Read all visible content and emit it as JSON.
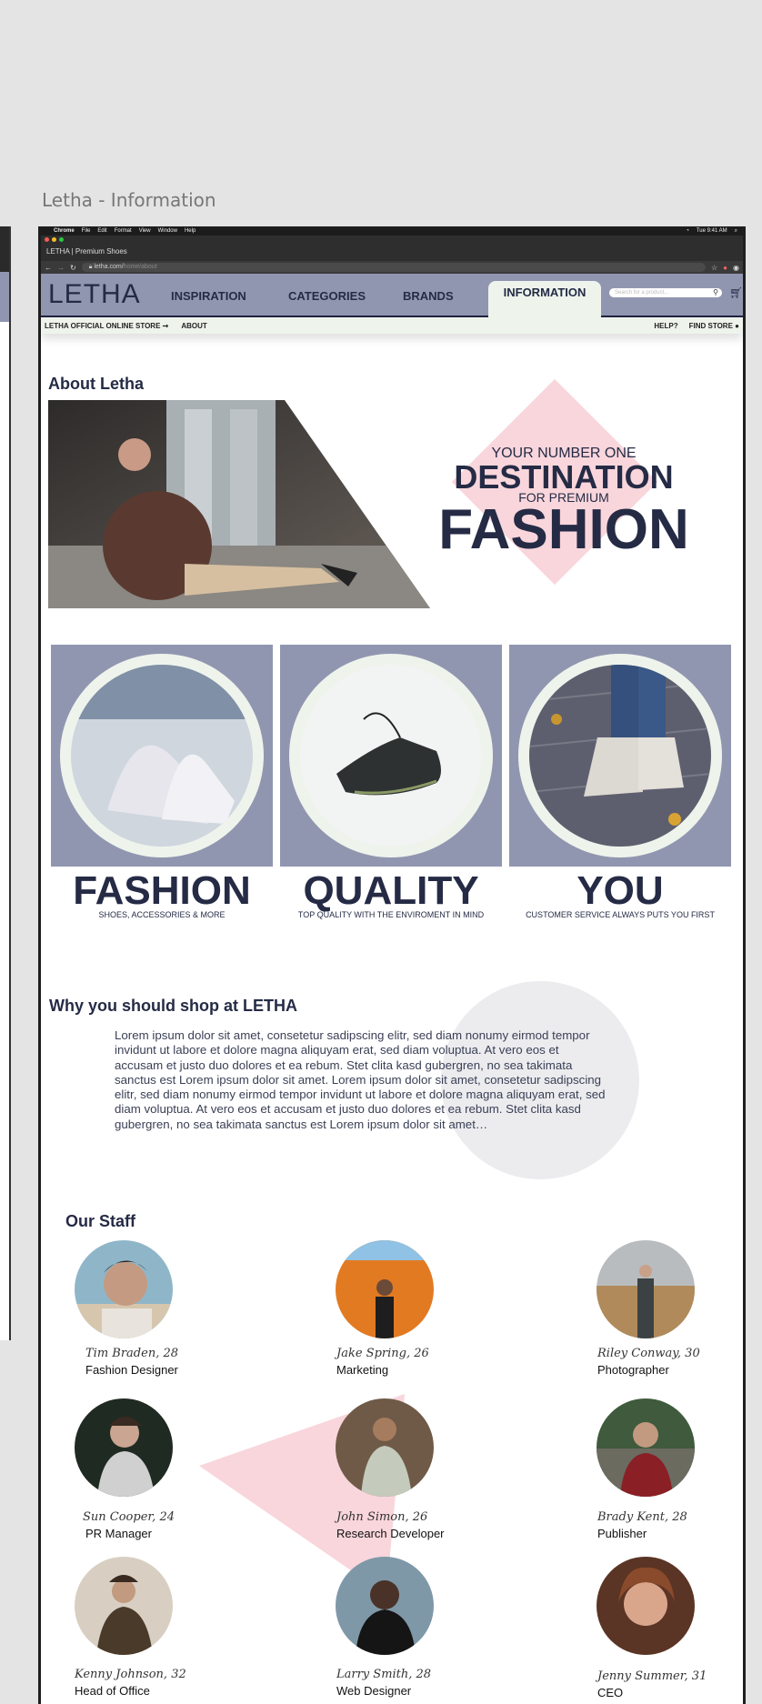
{
  "artboard_title": "Letha - Information",
  "os_menu": [
    "Chrome",
    "File",
    "Edit",
    "Format",
    "View",
    "Window",
    "Help"
  ],
  "os_time": "Tue 9:41 AM",
  "tab_title": "LETHA | Premium Shoes",
  "url": {
    "domain": "letha.com/",
    "path": "home/about"
  },
  "nav": {
    "logo": "LETHA",
    "items": [
      "INSPIRATION",
      "CATEGORIES",
      "BRANDS",
      "INFORMATION"
    ],
    "active": "INFORMATION",
    "search_placeholder": "Search for a product...",
    "search_icon": "search-icon",
    "cart_icon": "basket-icon"
  },
  "subnav": {
    "store": "LETHA OFFICIAL ONLINE STORE",
    "arrow": "➞",
    "about": "ABOUT",
    "help": "HELP?",
    "find_store": "FIND STORE"
  },
  "about": {
    "heading": "About Letha",
    "hero_line1": "YOUR NUMBER ONE",
    "hero_line2": "DESTINATION",
    "hero_line3": "FOR PREMIUM",
    "hero_line4": "FASHION"
  },
  "features": [
    {
      "title": "FASHION",
      "subtitle": "SHOES, ACCESSORIES & MORE"
    },
    {
      "title": "QUALITY",
      "subtitle": "TOP QUALITY WITH THE ENVIROMENT IN MIND"
    },
    {
      "title": "YOU",
      "subtitle": "CUSTOMER SERVICE ALWAYS PUTS YOU FIRST"
    }
  ],
  "why": {
    "heading": "Why you should shop at LETHA",
    "body": "Lorem ipsum dolor sit amet, consetetur sadipscing elitr, sed diam nonumy eirmod tempor invidunt ut labore et dolore magna aliquyam erat, sed diam voluptua. At vero eos et accusam et justo duo dolores et ea rebum. Stet clita kasd gubergren, no sea takimata sanctus est Lorem ipsum dolor sit amet. Lorem ipsum dolor sit amet, consetetur sadipscing elitr, sed diam nonumy eirmod tempor invidunt ut labore et dolore magna aliquyam erat, sed diam voluptua. At vero eos et accusam et justo duo dolores et ea rebum. Stet clita kasd gubergren, no sea takimata sanctus est Lorem ipsum dolor sit amet…"
  },
  "staff": {
    "heading": "Our Staff",
    "members": [
      {
        "name": "Tim Braden, 28",
        "role": "Fashion Designer"
      },
      {
        "name": "Jake Spring, 26",
        "role": "Marketing"
      },
      {
        "name": "Riley Conway, 30",
        "role": "Photographer"
      },
      {
        "name": "Sun Cooper, 24",
        "role": "PR Manager"
      },
      {
        "name": "John Simon, 26",
        "role": "Research Developer"
      },
      {
        "name": "Brady Kent, 28",
        "role": "Publisher"
      },
      {
        "name": "Kenny Johnson, 32",
        "role": "Head of Office"
      },
      {
        "name": "Larry Smith, 28",
        "role": "Web Designer"
      },
      {
        "name": "Jenny Summer, 31",
        "role": "CEO"
      }
    ]
  },
  "colors": {
    "nav": "#9196b0",
    "navy": "#252b45",
    "mint": "#eef4ec",
    "pink": "#f9d6dc"
  }
}
